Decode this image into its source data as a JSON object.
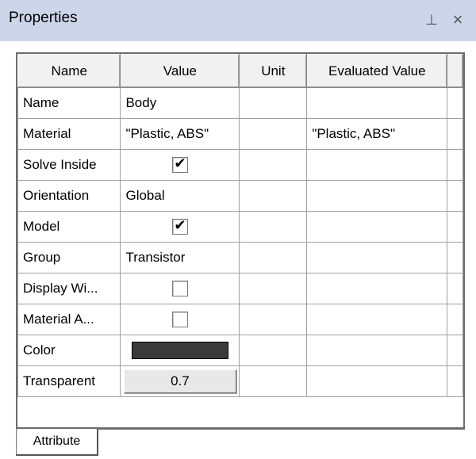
{
  "panel": {
    "title": "Properties",
    "pin_glyph": "⊥",
    "close_glyph": "×"
  },
  "grid": {
    "columns": [
      "Name",
      "Value",
      "Unit",
      "Evaluated Value"
    ],
    "rows": [
      {
        "name": "Name",
        "value": "Body",
        "unit": "",
        "evaluated": ""
      },
      {
        "name": "Material",
        "value": "\"Plastic, ABS\"",
        "unit": "",
        "evaluated": "\"Plastic, ABS\""
      },
      {
        "name": "Solve Inside",
        "checked": true,
        "unit": "",
        "evaluated": ""
      },
      {
        "name": "Orientation",
        "value": "Global",
        "unit": "",
        "evaluated": ""
      },
      {
        "name": "Model",
        "checked": true,
        "unit": "",
        "evaluated": ""
      },
      {
        "name": "Group",
        "value": "Transistor",
        "unit": "",
        "evaluated": ""
      },
      {
        "name": "Display Wi...",
        "checked": false,
        "unit": "",
        "evaluated": ""
      },
      {
        "name": "Material A...",
        "checked": false,
        "unit": "",
        "evaluated": ""
      },
      {
        "name": "Color",
        "color": "#3a3a3a",
        "unit": "",
        "evaluated": ""
      },
      {
        "name": "Transparent",
        "value": "0.7",
        "unit": "",
        "evaluated": ""
      }
    ]
  },
  "tabs": [
    {
      "label": "Attribute",
      "active": true
    }
  ],
  "check_glyph": "✔"
}
